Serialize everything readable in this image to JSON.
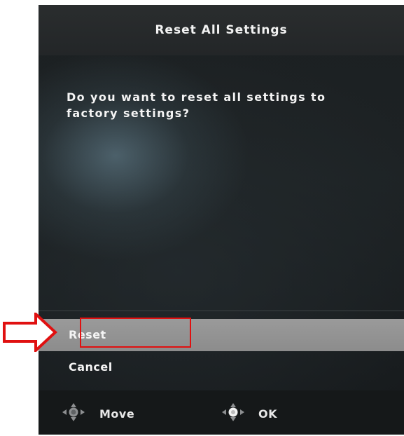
{
  "dialog": {
    "title": "Reset All Settings",
    "message": "Do you want to reset all settings to factory settings?"
  },
  "options": [
    {
      "label": "Reset",
      "selected": true
    },
    {
      "label": "Cancel",
      "selected": false
    }
  ],
  "footer": {
    "hints": [
      {
        "icon": "joystick-icon",
        "label": "Move"
      },
      {
        "icon": "joystick-icon",
        "label": "OK"
      }
    ]
  },
  "annotations": {
    "highlight_color": "#e01010",
    "arrow_color": "#e01010"
  },
  "colors": {
    "selected_row": "#8c8c8c",
    "text": "#f4f4f4",
    "background": "#1d2224"
  }
}
